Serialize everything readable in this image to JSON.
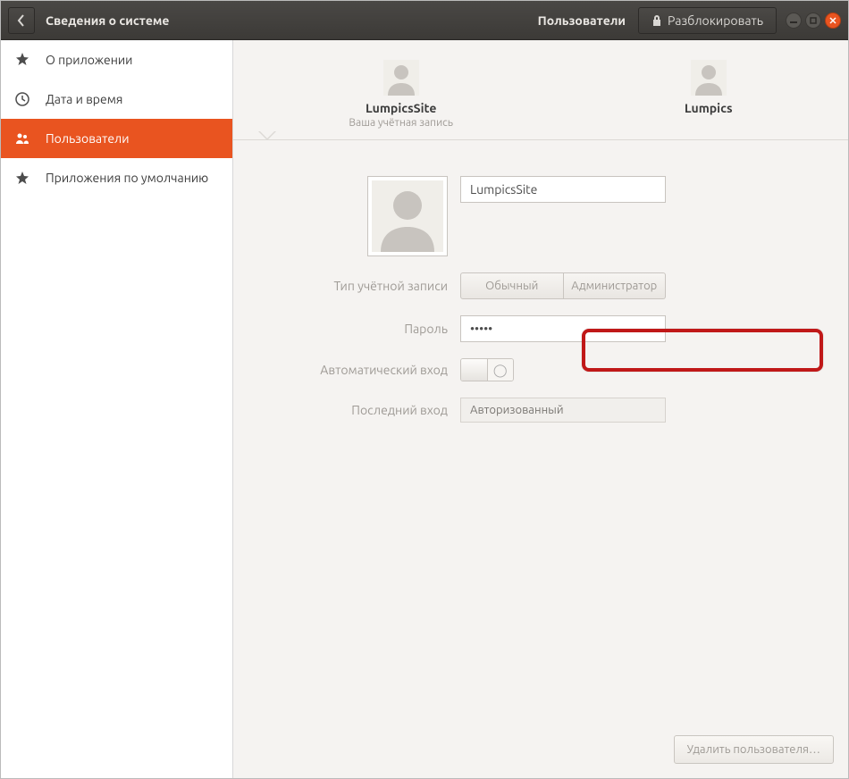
{
  "header": {
    "title": "Сведения о системе",
    "section": "Пользователи",
    "unlock": "Разблокировать"
  },
  "sidebar": {
    "items": [
      {
        "label": "О приложении"
      },
      {
        "label": "Дата и время"
      },
      {
        "label": "Пользователи"
      },
      {
        "label": "Приложения по умолчанию"
      }
    ]
  },
  "users": [
    {
      "name": "LumpicsSite",
      "subtitle": "Ваша учётная запись"
    },
    {
      "name": "Lumpics",
      "subtitle": ""
    }
  ],
  "form": {
    "name_value": "LumpicsSite",
    "account_type_label": "Тип учётной записи",
    "account_type_options": {
      "standard": "Обычный",
      "admin": "Администратор"
    },
    "password_label": "Пароль",
    "password_value": "•••••",
    "autologin_label": "Автоматический вход",
    "autologin_on": "|",
    "autologin_off": "◯",
    "lastlogin_label": "Последний вход",
    "lastlogin_value": "Авторизованный"
  },
  "footer": {
    "delete_user": "Удалить пользователя…"
  }
}
